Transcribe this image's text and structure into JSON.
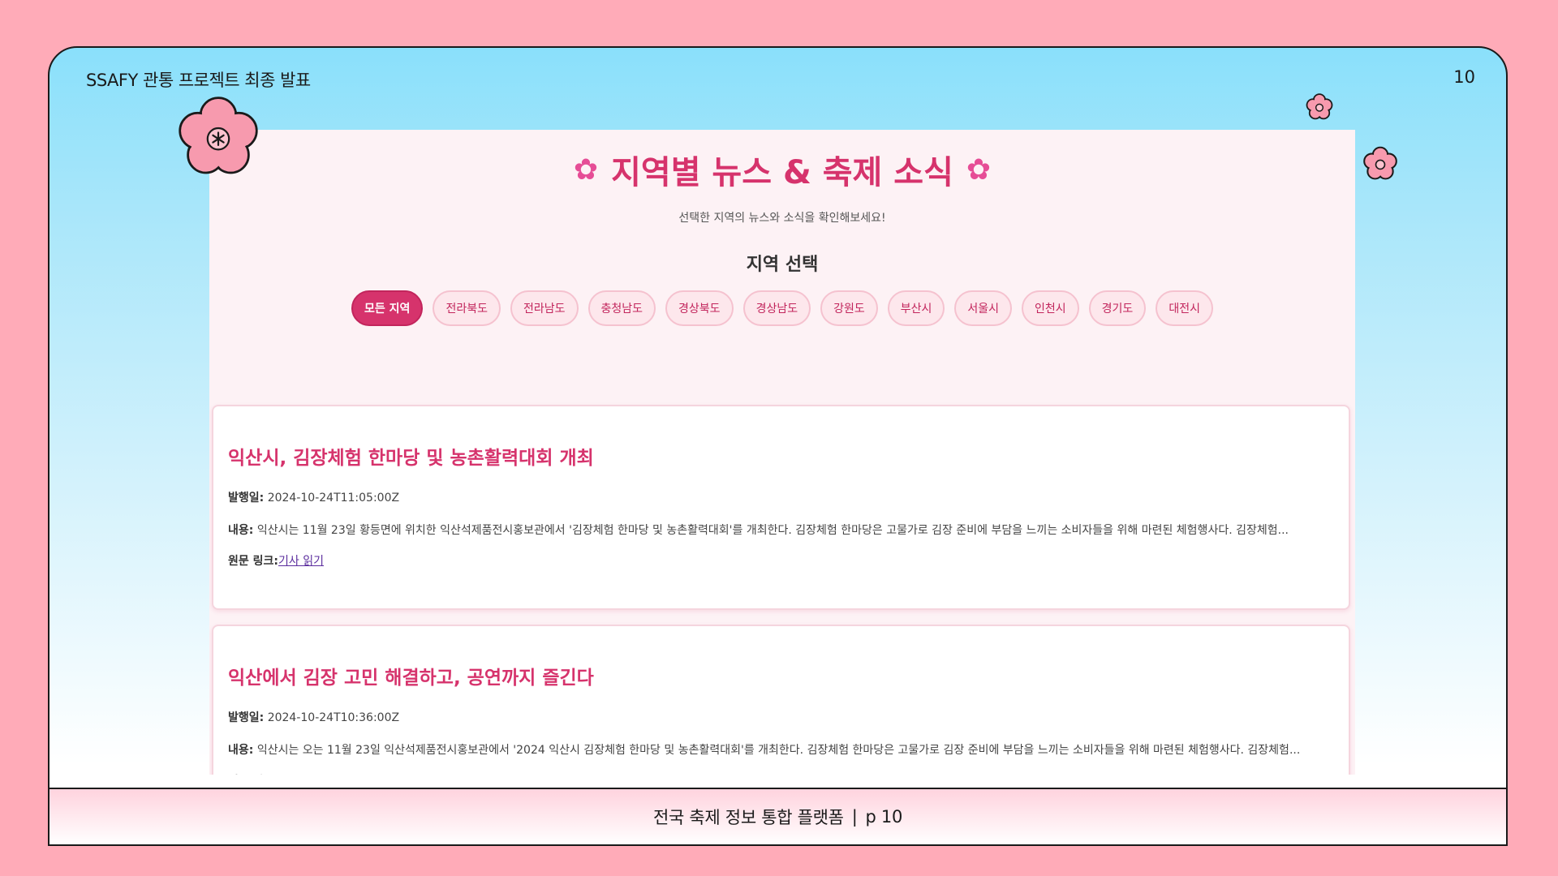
{
  "slide": {
    "header": "SSAFY 관통 프로젝트 최종 발표",
    "page_number": "10",
    "footer_text": "전국 축제 정보 통합 플랫폼",
    "footer_sep": "|",
    "footer_page": "p 10"
  },
  "app": {
    "title": "지역별 뉴스 & 축제 소식",
    "title_icon": "✿",
    "subtitle": "선택한 지역의 뉴스와 소식을 확인해보세요!",
    "region_heading": "지역 선택",
    "regions": [
      {
        "label": "모든 지역",
        "active": true
      },
      {
        "label": "전라북도"
      },
      {
        "label": "전라남도"
      },
      {
        "label": "충청남도"
      },
      {
        "label": "경상북도"
      },
      {
        "label": "경상남도"
      },
      {
        "label": "강원도"
      },
      {
        "label": "부산시"
      },
      {
        "label": "서울시"
      },
      {
        "label": "인천시"
      },
      {
        "label": "경기도"
      },
      {
        "label": "대전시"
      }
    ],
    "labels": {
      "date": "발행일:",
      "content": "내용:",
      "link": "원문 링크:",
      "link_text": "기사 읽기"
    },
    "news": [
      {
        "title": "익산시, 김장체험 한마당 및 농촌활력대회 개최",
        "date": "2024-10-24T11:05:00Z",
        "content": "익산시는 11월 23일 황등면에 위치한 익산석제품전시홍보관에서 '김장체험 한마당 및 농촌활력대회'를 개최한다. 김장체험 한마당은 고물가로 김장 준비에 부담을 느끼는 소비자들을 위해 마련된 체험행사다. 김장체험..."
      },
      {
        "title": "익산에서 김장 고민 해결하고, 공연까지 즐긴다",
        "date": "2024-10-24T10:36:00Z",
        "content": "익산시는 오는 11월 23일 익산석제품전시홍보관에서 '2024 익산시 김장체험 한마당 및 농촌활력대회'를 개최한다. 김장체험 한마당은 고물가로 김장 준비에 부담을 느끼는 소비자들을 위해 마련된 체험행사다. 김장체험..."
      }
    ]
  },
  "colors": {
    "page_bg": "#ffabb8",
    "accent": "#d6336c",
    "sky": "#8ae0fb",
    "flower": "#f79aae"
  }
}
